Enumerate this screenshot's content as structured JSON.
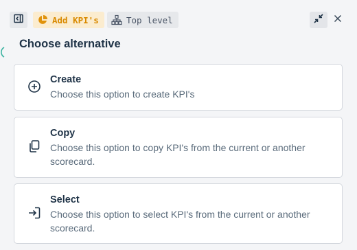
{
  "header": {
    "collapse_icon": "sidebar-collapse-icon",
    "kpi_tag": {
      "label": "Add KPI's",
      "icon": "pie-chart-icon",
      "color": "#d98a00",
      "background": "#fbeccf"
    },
    "level_tag": {
      "label": "Top level",
      "icon": "hierarchy-icon"
    },
    "shrink_icon": "minimize-icon",
    "close_icon": "close-icon"
  },
  "title": "Choose alternative",
  "options": [
    {
      "id": "create",
      "label": "Create",
      "description": "Choose this option to create KPI's",
      "icon": "plus-circle-icon"
    },
    {
      "id": "copy",
      "label": "Copy",
      "description": "Choose this option to copy KPI's from the current or another scorecard.",
      "icon": "copy-icon"
    },
    {
      "id": "select",
      "label": "Select",
      "description": "Choose this option to select KPI's from the current or another scorecard.",
      "icon": "sign-in-icon"
    }
  ],
  "colors": {
    "text_dark": "#1f3347",
    "text_muted": "#5a6b7b",
    "card_border": "#d3d7dd",
    "panel_bg": "#f4f5f7"
  }
}
